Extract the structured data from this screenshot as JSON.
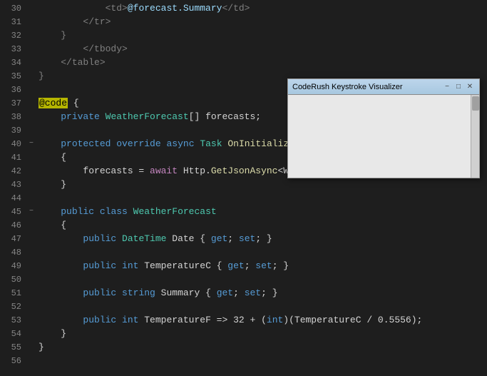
{
  "editor": {
    "background": "#1e1e1e",
    "lines": [
      {
        "num": "30",
        "indent": 0,
        "tokens": [
          {
            "t": "            "
          },
          {
            "cls": "html-tag",
            "t": "<td>"
          },
          {
            "cls": "attr",
            "t": "@forecast.Summary"
          },
          {
            "cls": "html-tag",
            "t": "</td>"
          }
        ]
      },
      {
        "num": "31",
        "indent": 0,
        "tokens": [
          {
            "t": "        "
          },
          {
            "cls": "html-tag",
            "t": "</tr>"
          }
        ]
      },
      {
        "num": "32",
        "indent": 0,
        "tokens": [
          {
            "t": "    "
          },
          {
            "cls": "html-tag",
            "t": "}"
          }
        ]
      },
      {
        "num": "33",
        "indent": 0,
        "tokens": [
          {
            "t": "        "
          },
          {
            "cls": "html-tag",
            "t": "</tbody>"
          }
        ]
      },
      {
        "num": "34",
        "indent": 0,
        "tokens": [
          {
            "t": "    "
          },
          {
            "cls": "html-tag",
            "t": "</table>"
          }
        ]
      },
      {
        "num": "35",
        "indent": 0,
        "tokens": [
          {
            "cls": "html-tag",
            "t": "}"
          }
        ]
      },
      {
        "num": "36",
        "indent": 0,
        "tokens": []
      },
      {
        "num": "37",
        "indent": 0,
        "tokens": [
          {
            "cls": "at-code",
            "t": "@code"
          },
          {
            "cls": "plain",
            "t": " {"
          }
        ]
      },
      {
        "num": "38",
        "indent": 0,
        "tokens": [
          {
            "t": "    "
          },
          {
            "cls": "kw",
            "t": "private"
          },
          {
            "cls": "plain",
            "t": " "
          },
          {
            "cls": "type",
            "t": "WeatherForecast"
          },
          {
            "cls": "plain",
            "t": "[] forecasts;"
          }
        ]
      },
      {
        "num": "39",
        "indent": 0,
        "tokens": []
      },
      {
        "num": "40",
        "collapsible": true,
        "indent": 0,
        "tokens": [
          {
            "t": "    "
          },
          {
            "cls": "kw",
            "t": "protected"
          },
          {
            "cls": "plain",
            "t": " "
          },
          {
            "cls": "kw",
            "t": "override"
          },
          {
            "cls": "plain",
            "t": " "
          },
          {
            "cls": "kw",
            "t": "async"
          },
          {
            "cls": "plain",
            "t": " "
          },
          {
            "cls": "type",
            "t": "Task"
          },
          {
            "cls": "plain",
            "t": " "
          },
          {
            "cls": "method",
            "t": "OnInitializedAs"
          },
          {
            "cls": "plain",
            "t": "..."
          }
        ]
      },
      {
        "num": "41",
        "indent": 0,
        "tokens": [
          {
            "t": "    {"
          }
        ]
      },
      {
        "num": "42",
        "indent": 0,
        "tokens": [
          {
            "t": "        forecasts = "
          },
          {
            "cls": "kw-ctrl",
            "t": "await"
          },
          {
            "cls": "plain",
            "t": " Http."
          },
          {
            "cls": "method",
            "t": "GetJsonAsync"
          },
          {
            "cls": "plain",
            "t": "<Weat"
          },
          {
            "cls": "plain",
            "t": "..."
          }
        ]
      },
      {
        "num": "43",
        "indent": 0,
        "tokens": [
          {
            "t": "    }"
          }
        ]
      },
      {
        "num": "44",
        "indent": 0,
        "tokens": []
      },
      {
        "num": "45",
        "collapsible": true,
        "indent": 0,
        "tokens": [
          {
            "t": "    "
          },
          {
            "cls": "kw",
            "t": "public"
          },
          {
            "cls": "plain",
            "t": " "
          },
          {
            "cls": "kw",
            "t": "class"
          },
          {
            "cls": "plain",
            "t": " "
          },
          {
            "cls": "type",
            "t": "WeatherForecast"
          }
        ]
      },
      {
        "num": "46",
        "indent": 0,
        "tokens": [
          {
            "t": "    {"
          }
        ]
      },
      {
        "num": "47",
        "indent": 0,
        "tokens": [
          {
            "t": "        "
          },
          {
            "cls": "kw",
            "t": "public"
          },
          {
            "cls": "plain",
            "t": " "
          },
          {
            "cls": "type",
            "t": "DateTime"
          },
          {
            "cls": "plain",
            "t": " Date { "
          },
          {
            "cls": "kw",
            "t": "get"
          },
          {
            "cls": "plain",
            "t": "; "
          },
          {
            "cls": "kw",
            "t": "set"
          },
          {
            "cls": "plain",
            "t": "; }"
          }
        ]
      },
      {
        "num": "48",
        "indent": 0,
        "tokens": []
      },
      {
        "num": "49",
        "indent": 0,
        "tokens": [
          {
            "t": "        "
          },
          {
            "cls": "kw",
            "t": "public"
          },
          {
            "cls": "plain",
            "t": " "
          },
          {
            "cls": "kw",
            "t": "int"
          },
          {
            "cls": "plain",
            "t": " TemperatureC { "
          },
          {
            "cls": "kw",
            "t": "get"
          },
          {
            "cls": "plain",
            "t": "; "
          },
          {
            "cls": "kw",
            "t": "set"
          },
          {
            "cls": "plain",
            "t": "; }"
          }
        ]
      },
      {
        "num": "50",
        "indent": 0,
        "tokens": []
      },
      {
        "num": "51",
        "indent": 0,
        "tokens": [
          {
            "t": "        "
          },
          {
            "cls": "kw",
            "t": "public"
          },
          {
            "cls": "plain",
            "t": " "
          },
          {
            "cls": "kw",
            "t": "string"
          },
          {
            "cls": "plain",
            "t": " Summary { "
          },
          {
            "cls": "kw",
            "t": "get"
          },
          {
            "cls": "plain",
            "t": "; "
          },
          {
            "cls": "kw",
            "t": "set"
          },
          {
            "cls": "plain",
            "t": "; }"
          }
        ]
      },
      {
        "num": "52",
        "indent": 0,
        "tokens": []
      },
      {
        "num": "53",
        "indent": 0,
        "tokens": [
          {
            "t": "        "
          },
          {
            "cls": "kw",
            "t": "public"
          },
          {
            "cls": "plain",
            "t": " "
          },
          {
            "cls": "kw",
            "t": "int"
          },
          {
            "cls": "plain",
            "t": " TemperatureF => 32 + ("
          },
          {
            "cls": "kw",
            "t": "int"
          },
          {
            "cls": "plain",
            "t": ")(TemperatureC / 0.5556);"
          }
        ]
      },
      {
        "num": "54",
        "indent": 0,
        "tokens": [
          {
            "t": "    }"
          }
        ]
      },
      {
        "num": "55",
        "indent": 0,
        "tokens": [
          {
            "cls": "plain",
            "t": "}"
          }
        ]
      },
      {
        "num": "56",
        "indent": 0,
        "tokens": []
      }
    ]
  },
  "keystroke_window": {
    "title": "CodeRush Keystroke Visualizer",
    "buttons": {
      "minimize": "−",
      "restore": "□",
      "close": "✕"
    }
  }
}
